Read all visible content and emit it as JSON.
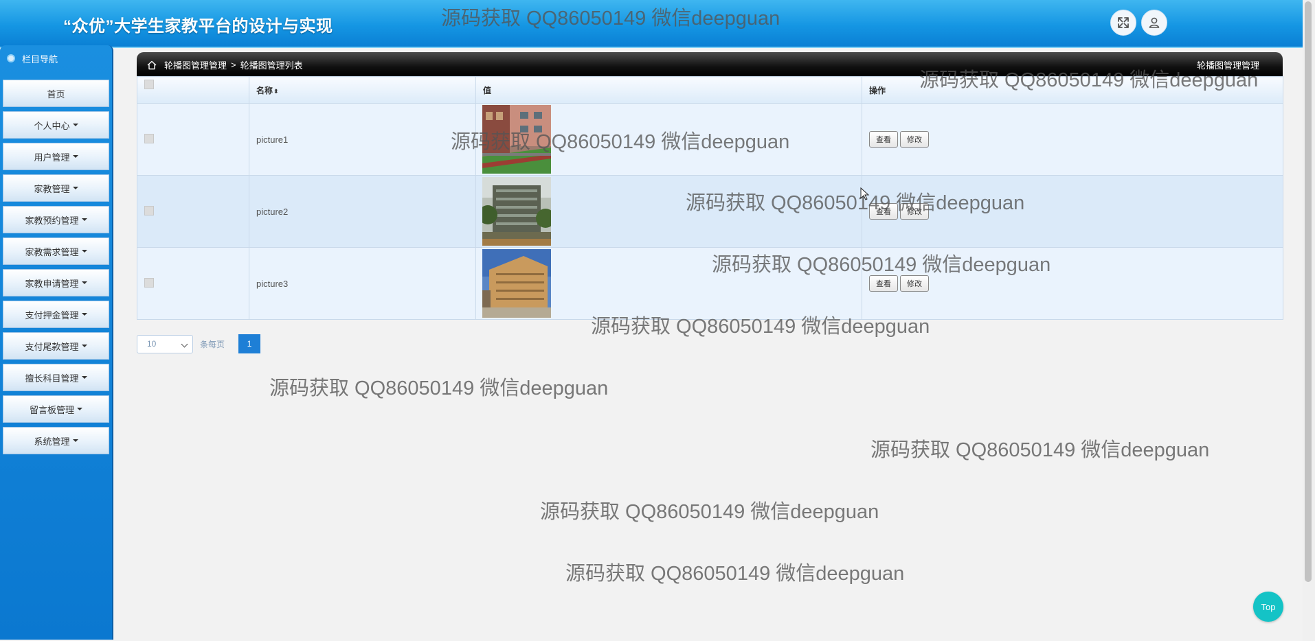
{
  "header": {
    "title": "“众优”大学生家教平台的设计与实现",
    "fullscreen_icon": "expand-icon",
    "user_icon": "user-icon"
  },
  "sidebar": {
    "heading": "栏目导航",
    "items": [
      {
        "label": "首页"
      },
      {
        "label": "个人中心"
      },
      {
        "label": "用户管理"
      },
      {
        "label": "家教管理"
      },
      {
        "label": "家教预约管理"
      },
      {
        "label": "家教需求管理"
      },
      {
        "label": "家教申请管理"
      },
      {
        "label": "支付押金管理"
      },
      {
        "label": "支付尾款管理"
      },
      {
        "label": "擅长科目管理"
      },
      {
        "label": "留言板管理"
      },
      {
        "label": "系统管理"
      }
    ]
  },
  "breadcrumb": {
    "section": "轮播图管理管理",
    "separator": ">",
    "page": "轮播图管理列表",
    "right_label": "轮播图管理管理"
  },
  "table": {
    "columns": {
      "name": "名称",
      "value": "值",
      "actions": "操作"
    },
    "rows": [
      {
        "name": "picture1",
        "image": "red brick school building with green field",
        "view": "查看",
        "edit": "修改"
      },
      {
        "name": "picture2",
        "image": "multi-storey building among trees",
        "view": "查看",
        "edit": "修改"
      },
      {
        "name": "picture3",
        "image": "campus building under blue sky",
        "view": "查看",
        "edit": "修改"
      }
    ]
  },
  "pagination": {
    "page_size": "10",
    "per_page_label": "条每页",
    "current_page": "1"
  },
  "watermark": "源码获取 QQ86050149 微信deepguan",
  "top_button": "Top",
  "colors": {
    "header": "#1596e3",
    "sidebar": "#0b78d0",
    "breadcrumb_bar": "#000000",
    "page_button": "#1e7fd6",
    "top_button": "#14c3c6"
  }
}
